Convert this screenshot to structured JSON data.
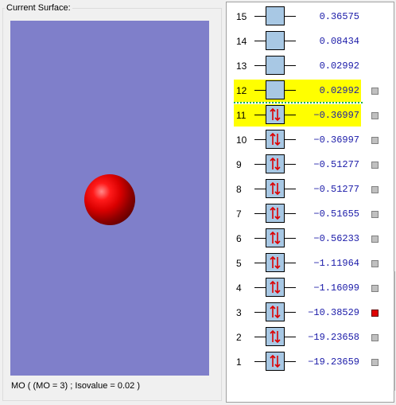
{
  "surface_panel": {
    "title": "Current Surface:",
    "caption": "MO ( (MO = 3) ; Isovalue = 0.02 )"
  },
  "orbitals": [
    {
      "index": "15",
      "energy": "0.36575",
      "occupied": false,
      "highlighted": false,
      "selectable": false
    },
    {
      "index": "14",
      "energy": "0.08434",
      "occupied": false,
      "highlighted": false,
      "selectable": false
    },
    {
      "index": "13",
      "energy": "0.02992",
      "occupied": false,
      "highlighted": false,
      "selectable": false
    },
    {
      "index": "12",
      "energy": "0.02992",
      "occupied": false,
      "highlighted": true,
      "selectable": true
    },
    {
      "index": "11",
      "energy": "−0.36997",
      "occupied": true,
      "highlighted": true,
      "selectable": true
    },
    {
      "index": "10",
      "energy": "−0.36997",
      "occupied": true,
      "highlighted": false,
      "selectable": true
    },
    {
      "index": "9",
      "energy": "−0.51277",
      "occupied": true,
      "highlighted": false,
      "selectable": true
    },
    {
      "index": "8",
      "energy": "−0.51277",
      "occupied": true,
      "highlighted": false,
      "selectable": true
    },
    {
      "index": "7",
      "energy": "−0.51655",
      "occupied": true,
      "highlighted": false,
      "selectable": true
    },
    {
      "index": "6",
      "energy": "−0.56233",
      "occupied": true,
      "highlighted": false,
      "selectable": true
    },
    {
      "index": "5",
      "energy": "−1.11964",
      "occupied": true,
      "highlighted": false,
      "selectable": true
    },
    {
      "index": "4",
      "energy": "−1.16099",
      "occupied": true,
      "highlighted": false,
      "selectable": true
    },
    {
      "index": "3",
      "energy": "−10.38529",
      "occupied": true,
      "highlighted": false,
      "selectable": true,
      "selected": true
    },
    {
      "index": "2",
      "energy": "−19.23658",
      "occupied": true,
      "highlighted": false,
      "selectable": true
    },
    {
      "index": "1",
      "energy": "−19.23659",
      "occupied": true,
      "highlighted": false,
      "selectable": true
    }
  ],
  "colors": {
    "viewport_background": "#7f7fca",
    "highlight": "#ffff00",
    "energy_text": "#1a1aa8",
    "orbital_box": "#a8c8e4",
    "electron_arrows": "#dd0000",
    "selected_marker": "#e00000"
  }
}
